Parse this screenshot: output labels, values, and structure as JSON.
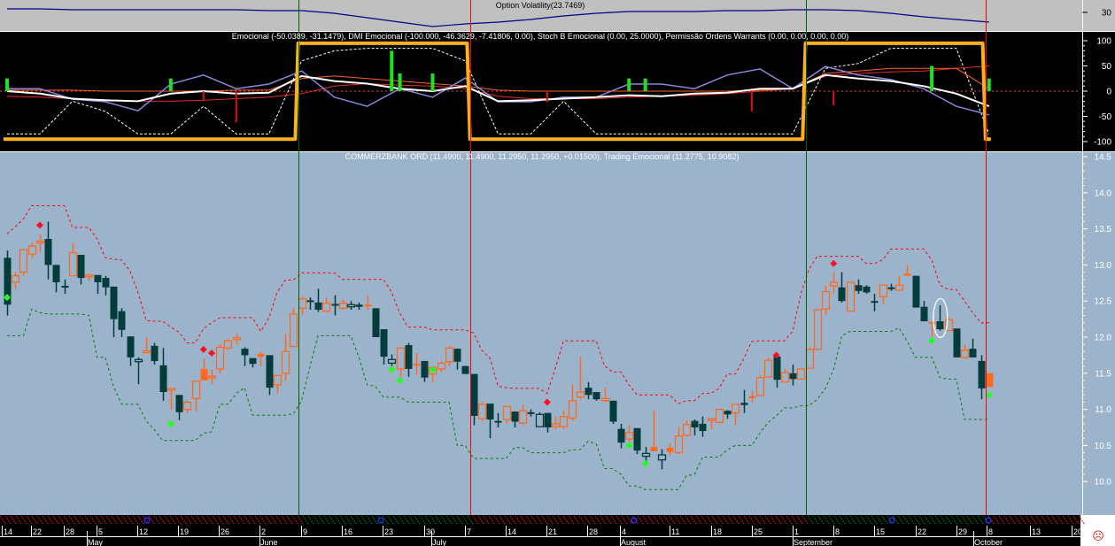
{
  "colors": {
    "volatility_bg": "#c0c0c0",
    "oscillator_bg": "#000000",
    "price_bg": "#9bb3cb",
    "candle_down": "#033c3c",
    "candle_up": "#ff6a1f",
    "upper_band": "#ff0000",
    "lower_band": "#008000",
    "regime_line": "#ffb020",
    "volatility_line": "#00008b",
    "lavender_line": "#8888dd"
  },
  "volatility_panel": {
    "title": "Option Volatility(23.7469)",
    "axis_labels": [
      "30"
    ],
    "axis_values": [
      30
    ],
    "values": [
      31.6,
      31.6,
      31.2,
      31.2,
      31.2,
      31.2,
      31.2,
      31.2,
      30.8,
      30.8,
      29.6,
      27.6,
      25.6,
      23.6,
      24.8,
      25.6,
      26.8,
      28.4,
      29.6,
      30.4,
      30.4,
      30.4,
      30.8,
      30.8,
      31.2,
      31.2,
      30.8,
      29.6,
      28.0,
      26.8,
      25.6
    ]
  },
  "oscillator_panel": {
    "title": "Emocional (-50.0389, -31.1479), DMI Emocional (-100.000, -46.3629, -7.41806, 0.00), Stoch B Emocional (0.00, 25.0000), Permissão Ordens Warrants (0.00, 0.00, 0.00, 0.00)",
    "axis_labels": [
      "100",
      "50",
      "0",
      "-50",
      "-100"
    ],
    "axis_values": [
      100,
      50,
      0,
      -50,
      -100
    ],
    "sample_step": 4,
    "lavender": [
      5,
      5,
      -16,
      -21,
      -39,
      14,
      32,
      5,
      14,
      40,
      -12,
      -30,
      5,
      -12,
      26,
      -21,
      -21,
      -12,
      -12,
      14,
      14,
      5,
      32,
      44,
      5,
      49,
      32,
      23,
      5,
      -30,
      -47
    ],
    "white": [
      0,
      -5,
      -15,
      -18,
      -20,
      -5,
      0,
      -5,
      -3,
      30,
      20,
      15,
      5,
      0,
      10,
      -20,
      -18,
      -15,
      -12,
      -8,
      -10,
      -5,
      -3,
      5,
      5,
      32,
      25,
      20,
      10,
      -5,
      -30
    ],
    "red_slow": [
      -10,
      -12,
      -15,
      -18,
      -20,
      -20,
      -18,
      -15,
      -12,
      -5,
      10,
      15,
      12,
      10,
      5,
      -10,
      -15,
      -15,
      -15,
      -12,
      -10,
      -8,
      -5,
      0,
      5,
      30,
      35,
      38,
      40,
      45,
      50
    ],
    "red_fast": [
      2,
      2,
      2,
      0,
      0,
      0,
      0,
      2,
      2,
      25,
      30,
      25,
      20,
      15,
      10,
      2,
      0,
      0,
      0,
      0,
      0,
      0,
      0,
      2,
      5,
      35,
      40,
      45,
      45,
      45,
      5
    ],
    "white_dashed": [
      -85,
      -85,
      -20,
      -40,
      -85,
      -85,
      -30,
      -85,
      -85,
      60,
      80,
      85,
      85,
      85,
      60,
      -85,
      -85,
      -20,
      -85,
      -85,
      -85,
      -85,
      -85,
      -85,
      -85,
      45,
      55,
      85,
      85,
      85,
      -85
    ],
    "regimes": [
      {
        "from": 0,
        "to": 35,
        "state": -95
      },
      {
        "from": 36,
        "to": 56,
        "state": 95
      },
      {
        "from": 57,
        "to": 97,
        "state": -95
      },
      {
        "from": 98,
        "to": 119,
        "state": 95
      },
      {
        "from": 120,
        "to": 120,
        "state": -95
      }
    ],
    "green_bars": [
      {
        "i": 0,
        "v": 25
      },
      {
        "i": 20,
        "v": 25
      },
      {
        "i": 47,
        "v": 80
      },
      {
        "i": 48,
        "v": 35
      },
      {
        "i": 52,
        "v": 35
      },
      {
        "i": 76,
        "v": 25
      },
      {
        "i": 78,
        "v": 25
      },
      {
        "i": 113,
        "v": 50
      },
      {
        "i": 120,
        "v": 25
      }
    ],
    "red_bars": [
      {
        "i": 24,
        "v": -18
      },
      {
        "i": 28,
        "v": -62
      },
      {
        "i": 66,
        "v": -22
      },
      {
        "i": 91,
        "v": -40
      },
      {
        "i": 101,
        "v": -28
      }
    ]
  },
  "price_panel": {
    "title": "COMMERZBANK ORD (11.4900, 11.4900, 11.2950, 11.2950, +0.01500), Trading Emocional (11.2775, 10.9082)",
    "axis_labels": [
      "14.5",
      "14.0",
      "13.5",
      "13.0",
      "12.5",
      "12.0",
      "11.5",
      "11.0",
      "10.5",
      "10.0"
    ],
    "axis_values": [
      14.5,
      14.0,
      13.5,
      13.0,
      12.5,
      12.0,
      11.5,
      11.0,
      10.5,
      10.0
    ],
    "candles": [
      [
        13.1,
        13.2,
        12.3,
        12.45,
        "d"
      ],
      [
        12.76,
        12.9,
        12.67,
        12.85,
        "o"
      ],
      [
        12.9,
        13.21,
        12.85,
        13.21,
        "o"
      ],
      [
        13.15,
        13.31,
        13.1,
        13.26,
        "o"
      ],
      [
        13.32,
        13.42,
        13.18,
        13.33,
        "o"
      ],
      [
        13.36,
        13.6,
        12.8,
        13.0,
        "d"
      ],
      [
        13.0,
        13.0,
        12.62,
        12.76,
        "d"
      ],
      [
        12.71,
        12.8,
        12.6,
        12.7,
        "d"
      ],
      [
        12.85,
        13.3,
        12.85,
        13.17,
        "o"
      ],
      [
        13.14,
        13.14,
        12.73,
        12.82,
        "d"
      ],
      [
        12.84,
        12.88,
        12.78,
        12.86,
        "o"
      ],
      [
        12.86,
        12.86,
        12.6,
        12.76,
        "d"
      ],
      [
        12.82,
        12.85,
        12.58,
        12.69,
        "d"
      ],
      [
        12.7,
        12.7,
        12.0,
        12.25,
        "d"
      ],
      [
        12.36,
        12.4,
        12.0,
        12.1,
        "d"
      ],
      [
        12.01,
        12.01,
        11.6,
        11.72,
        "d"
      ],
      [
        11.66,
        11.72,
        11.35,
        11.69,
        "dh"
      ],
      [
        11.79,
        12.0,
        11.78,
        11.81,
        "o"
      ],
      [
        11.88,
        11.92,
        11.62,
        11.67,
        "d"
      ],
      [
        11.61,
        11.85,
        11.12,
        11.24,
        "d"
      ],
      [
        11.27,
        11.28,
        11.0,
        11.29,
        "o"
      ],
      [
        11.2,
        11.2,
        10.85,
        10.96,
        "d"
      ],
      [
        11.0,
        11.12,
        10.95,
        11.1,
        "o"
      ],
      [
        11.15,
        11.4,
        10.97,
        11.39,
        "o"
      ],
      [
        11.4,
        11.7,
        11.4,
        11.56,
        "of"
      ],
      [
        11.44,
        11.55,
        11.35,
        11.46,
        "o"
      ],
      [
        11.56,
        11.9,
        11.5,
        11.86,
        "o"
      ],
      [
        11.85,
        11.98,
        11.82,
        11.95,
        "o"
      ],
      [
        11.97,
        12.05,
        11.9,
        11.99,
        "o"
      ],
      [
        11.84,
        11.86,
        11.6,
        11.75,
        "d"
      ],
      [
        11.71,
        11.71,
        11.58,
        11.63,
        "d"
      ],
      [
        11.73,
        11.8,
        11.6,
        11.77,
        "of"
      ],
      [
        11.75,
        11.75,
        11.2,
        11.3,
        "d"
      ],
      [
        11.34,
        11.47,
        11.22,
        11.47,
        "o"
      ],
      [
        11.5,
        12.05,
        11.4,
        11.8,
        "o"
      ],
      [
        11.87,
        12.4,
        11.87,
        12.32,
        "o"
      ],
      [
        12.4,
        12.57,
        12.3,
        12.53,
        "o"
      ],
      [
        12.5,
        12.55,
        12.38,
        12.51,
        "d"
      ],
      [
        12.48,
        12.67,
        12.35,
        12.38,
        "d"
      ],
      [
        12.36,
        12.55,
        12.34,
        12.47,
        "o"
      ],
      [
        12.46,
        12.58,
        12.3,
        12.45,
        "d"
      ],
      [
        12.4,
        12.52,
        12.38,
        12.47,
        "o"
      ],
      [
        12.42,
        12.5,
        12.38,
        12.45,
        "dh"
      ],
      [
        12.45,
        12.48,
        12.38,
        12.42,
        "d"
      ],
      [
        12.44,
        12.58,
        12.38,
        12.45,
        "of"
      ],
      [
        12.4,
        12.4,
        12.0,
        12.0,
        "d"
      ],
      [
        12.11,
        12.11,
        11.62,
        11.73,
        "d"
      ],
      [
        11.64,
        11.76,
        11.6,
        11.69,
        "dh"
      ],
      [
        11.56,
        11.85,
        11.45,
        11.85,
        "o"
      ],
      [
        11.89,
        11.92,
        11.45,
        11.56,
        "d"
      ],
      [
        11.61,
        11.78,
        11.48,
        11.63,
        "of"
      ],
      [
        11.67,
        11.67,
        11.38,
        11.44,
        "d"
      ],
      [
        11.49,
        11.6,
        11.38,
        11.58,
        "o"
      ],
      [
        11.56,
        11.66,
        11.52,
        11.64,
        "o"
      ],
      [
        11.66,
        11.88,
        11.6,
        11.85,
        "o"
      ],
      [
        11.84,
        11.84,
        11.55,
        11.66,
        "d"
      ],
      [
        11.6,
        11.6,
        11.49,
        11.49,
        "d"
      ],
      [
        11.49,
        11.49,
        10.78,
        10.91,
        "d"
      ],
      [
        10.87,
        11.1,
        10.84,
        11.07,
        "o"
      ],
      [
        11.08,
        11.08,
        10.6,
        10.86,
        "d"
      ],
      [
        10.84,
        10.95,
        10.75,
        10.83,
        "d"
      ],
      [
        10.86,
        11.04,
        10.8,
        11.04,
        "o"
      ],
      [
        10.97,
        10.97,
        10.75,
        10.83,
        "d"
      ],
      [
        10.81,
        11.07,
        10.78,
        10.98,
        "o"
      ],
      [
        10.96,
        11.0,
        10.9,
        10.95,
        "d"
      ],
      [
        10.76,
        10.96,
        10.76,
        10.93,
        "dh"
      ],
      [
        10.95,
        10.95,
        10.68,
        10.75,
        "d"
      ],
      [
        10.76,
        10.9,
        10.72,
        10.8,
        "o"
      ],
      [
        10.76,
        10.98,
        10.72,
        10.9,
        "o"
      ],
      [
        10.88,
        11.35,
        10.84,
        11.12,
        "o"
      ],
      [
        11.17,
        11.73,
        11.15,
        11.24,
        "o"
      ],
      [
        11.3,
        11.38,
        11.14,
        11.2,
        "d"
      ],
      [
        11.24,
        11.24,
        11.12,
        11.14,
        "d"
      ],
      [
        11.12,
        11.3,
        11.1,
        11.15,
        "o"
      ],
      [
        11.12,
        11.12,
        10.8,
        10.83,
        "d"
      ],
      [
        10.73,
        10.8,
        10.46,
        10.54,
        "d"
      ],
      [
        10.59,
        10.78,
        10.52,
        10.68,
        "o"
      ],
      [
        10.74,
        10.74,
        10.38,
        10.43,
        "d"
      ],
      [
        10.35,
        10.48,
        10.22,
        10.39,
        "dh"
      ],
      [
        10.42,
        10.98,
        10.42,
        10.48,
        "of"
      ],
      [
        10.3,
        10.45,
        10.17,
        10.37,
        "dh"
      ],
      [
        10.41,
        10.52,
        10.36,
        10.47,
        "of"
      ],
      [
        10.4,
        10.75,
        10.38,
        10.63,
        "o"
      ],
      [
        10.64,
        10.85,
        10.62,
        10.79,
        "o"
      ],
      [
        10.84,
        10.86,
        10.64,
        10.75,
        "d"
      ],
      [
        10.8,
        10.9,
        10.62,
        10.7,
        "d"
      ],
      [
        10.85,
        10.88,
        10.72,
        10.87,
        "o"
      ],
      [
        10.82,
        11.0,
        10.8,
        11.0,
        "o"
      ],
      [
        10.98,
        10.99,
        10.87,
        10.93,
        "d"
      ],
      [
        10.95,
        11.07,
        10.78,
        11.07,
        "o"
      ],
      [
        11.09,
        11.27,
        10.95,
        11.06,
        "d"
      ],
      [
        11.17,
        11.25,
        11.1,
        11.18,
        "of"
      ],
      [
        11.19,
        11.48,
        11.19,
        11.44,
        "o"
      ],
      [
        11.45,
        11.72,
        11.45,
        11.68,
        "o"
      ],
      [
        11.73,
        11.73,
        11.3,
        11.41,
        "d"
      ],
      [
        11.38,
        11.56,
        11.38,
        11.51,
        "o"
      ],
      [
        11.5,
        11.62,
        11.33,
        11.42,
        "d"
      ],
      [
        11.42,
        11.56,
        11.42,
        11.56,
        "o"
      ],
      [
        11.57,
        11.86,
        11.57,
        11.83,
        "o"
      ],
      [
        11.83,
        12.38,
        11.83,
        12.38,
        "o"
      ],
      [
        12.39,
        12.72,
        12.3,
        12.63,
        "o"
      ],
      [
        12.71,
        12.9,
        12.6,
        12.76,
        "o"
      ],
      [
        12.69,
        12.9,
        12.48,
        12.5,
        "d"
      ],
      [
        12.36,
        12.76,
        12.36,
        12.76,
        "o"
      ],
      [
        12.72,
        12.8,
        12.6,
        12.64,
        "d"
      ],
      [
        12.7,
        12.72,
        12.6,
        12.62,
        "d"
      ],
      [
        12.5,
        12.6,
        12.36,
        12.5,
        "d"
      ],
      [
        12.56,
        12.72,
        12.46,
        12.72,
        "o"
      ],
      [
        12.69,
        12.74,
        12.64,
        12.69,
        "d"
      ],
      [
        12.65,
        12.85,
        12.65,
        12.72,
        "o"
      ],
      [
        12.85,
        13.0,
        12.85,
        12.88,
        "of"
      ],
      [
        12.85,
        12.85,
        12.41,
        12.41,
        "d"
      ],
      [
        12.42,
        12.5,
        12.22,
        12.22,
        "d"
      ],
      [
        12.21,
        12.22,
        12.0,
        12.21,
        "of"
      ],
      [
        12.22,
        12.44,
        12.09,
        12.11,
        "d"
      ],
      [
        12.09,
        12.28,
        12.09,
        12.24,
        "o"
      ],
      [
        12.12,
        12.12,
        11.72,
        11.72,
        "d"
      ],
      [
        11.72,
        11.9,
        11.7,
        11.82,
        "o"
      ],
      [
        11.84,
        11.98,
        11.72,
        11.72,
        "d"
      ],
      [
        11.67,
        11.75,
        11.14,
        11.29,
        "d"
      ],
      [
        11.31,
        11.5,
        11.31,
        11.5,
        "of"
      ]
    ],
    "signals": [
      {
        "i": 4,
        "v": 13.55,
        "type": "sell"
      },
      {
        "i": 24,
        "v": 11.83,
        "type": "sell"
      },
      {
        "i": 25,
        "v": 11.78,
        "type": "sell"
      },
      {
        "i": 66,
        "v": 11.1,
        "type": "sell"
      },
      {
        "i": 94,
        "v": 11.75,
        "type": "sell"
      },
      {
        "i": 101,
        "v": 13.02,
        "type": "sell"
      },
      {
        "i": 0,
        "v": 12.55,
        "type": "buy"
      },
      {
        "i": 20,
        "v": 10.8,
        "type": "buy"
      },
      {
        "i": 47,
        "v": 11.55,
        "type": "buy"
      },
      {
        "i": 48,
        "v": 11.4,
        "type": "buy"
      },
      {
        "i": 52,
        "v": 11.55,
        "type": "buy"
      },
      {
        "i": 76,
        "v": 10.5,
        "type": "buy"
      },
      {
        "i": 78,
        "v": 10.25,
        "type": "buy"
      },
      {
        "i": 113,
        "v": 11.95,
        "type": "buy"
      },
      {
        "i": 120,
        "v": 11.2,
        "type": "buy"
      }
    ],
    "highlight_candle": 114
  },
  "period_markers": [
    {
      "i": 36,
      "color": "#006000"
    },
    {
      "i": 57,
      "color": "#ff0000"
    },
    {
      "i": 98,
      "color": "#006000"
    },
    {
      "i": 120,
      "color": "#ff0000"
    }
  ],
  "time_axis": {
    "day_ticks": [
      "14",
      "22",
      "28",
      "5",
      "12",
      "19",
      "26",
      "2",
      "9",
      "16",
      "23",
      "30",
      "7",
      "14",
      "21",
      "28",
      "4",
      "11",
      "18",
      "25",
      "1",
      "8",
      "15",
      "22",
      "29",
      "8",
      "13",
      "20"
    ],
    "months": [
      "May",
      "June",
      "July",
      "August",
      "September",
      "October"
    ]
  },
  "status_icon": "sad-face-icon"
}
